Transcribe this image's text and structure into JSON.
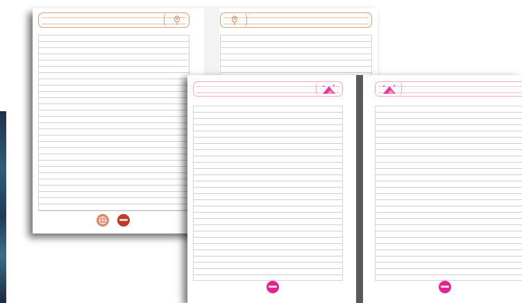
{
  "colors": {
    "back_accent": "#d9a07a",
    "back_badge_light": "#d98a6b",
    "back_badge_dark": "#c0392b",
    "front_accent": "#f4a6c6",
    "front_icon": "#e5379b",
    "front_badge": "#e0268f",
    "rule": "#cfcfcf",
    "gutter_dark": "#5a5a5a"
  },
  "pages": [
    {
      "name": "back-left",
      "icon": "tulip-icon"
    },
    {
      "name": "back-right",
      "icon": "tulip-icon"
    },
    {
      "name": "front-left",
      "icon": "mountain-icon"
    },
    {
      "name": "front-right",
      "icon": "mountain-icon"
    }
  ]
}
